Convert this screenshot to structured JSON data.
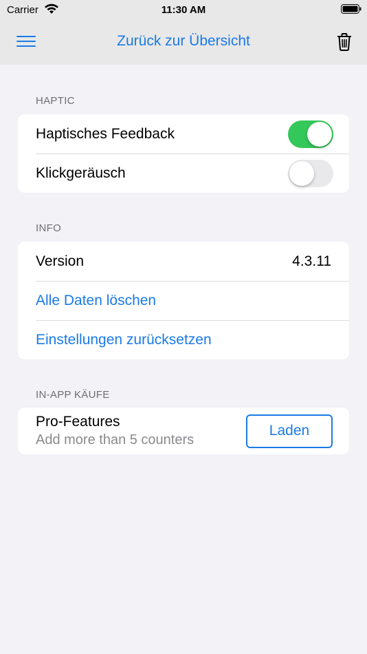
{
  "status_bar": {
    "carrier": "Carrier",
    "time": "11:30 AM"
  },
  "nav": {
    "title": "Zurück zur Übersicht",
    "menu_icon": "hamburger-menu-icon",
    "trash_icon": "trash-icon"
  },
  "sections": {
    "haptic": {
      "header": "HAPTIC",
      "items": [
        {
          "label": "Haptisches Feedback",
          "toggle": "on"
        },
        {
          "label": "Klickgeräusch",
          "toggle": "off"
        }
      ]
    },
    "info": {
      "header": "INFO",
      "version_label": "Version",
      "version_value": "4.3.11",
      "delete_all": "Alle Daten löschen",
      "reset_settings": "Einstellungen zurücksetzen"
    },
    "iap": {
      "header": "IN-APP KÄUFE",
      "pro_title": "Pro-Features",
      "pro_subtitle": "Add more than 5 counters",
      "load_button": "Laden"
    }
  },
  "colors": {
    "accent": "#1a7ae6",
    "toggle_on": "#34c759",
    "toggle_off": "#e9e9eb",
    "background": "#f2f2f7"
  }
}
